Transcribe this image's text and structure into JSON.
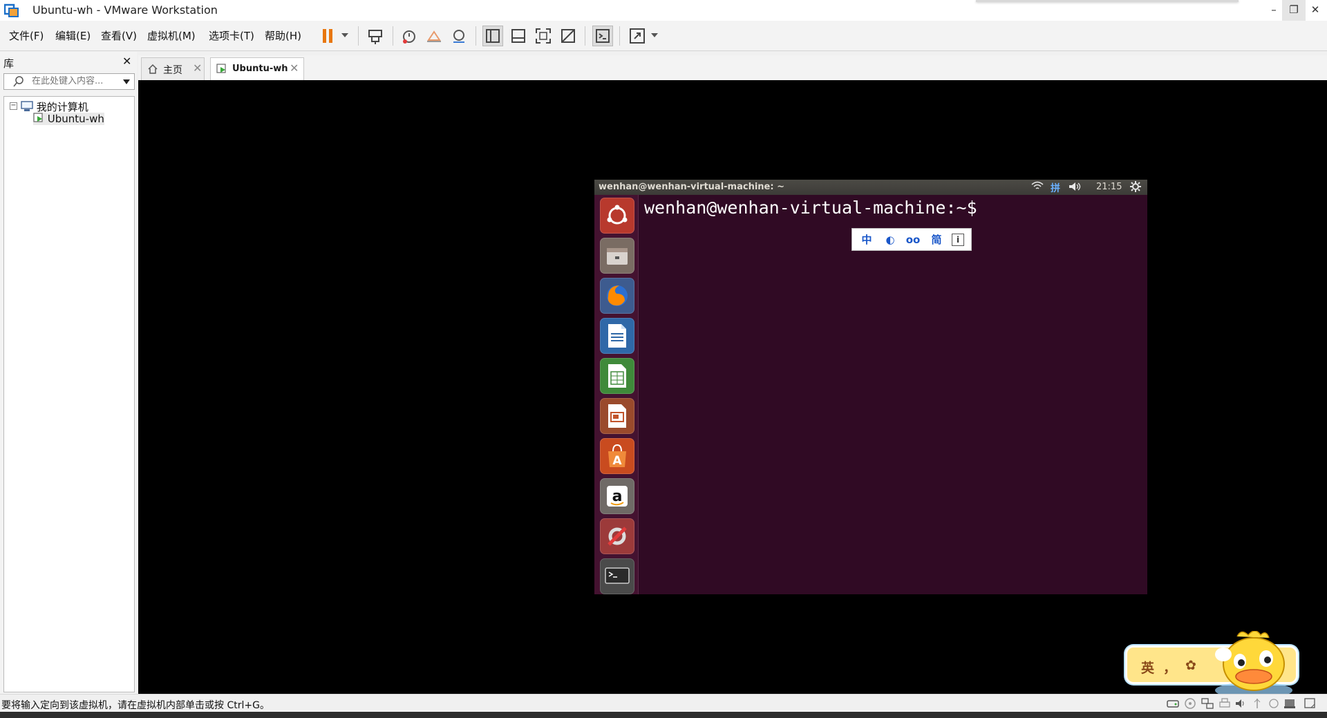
{
  "window": {
    "title": "Ubuntu-wh - VMware Workstation",
    "minimize": "–",
    "restore": "❐",
    "close": "✕"
  },
  "menu": {
    "file": "文件(F)",
    "edit": "编辑(E)",
    "view": "查看(V)",
    "vm": "虚拟机(M)",
    "tabs": "选项卡(T)",
    "help": "帮助(H)"
  },
  "toolbar": {
    "icons": [
      "pause-icon",
      "send-ctrl-alt-del-icon",
      "snapshot-icon",
      "revert-snapshot-icon",
      "snapshot-manager-icon",
      "show-library-icon",
      "show-thumbnail-icon",
      "full-screen-icon",
      "unity-icon",
      "console-view-icon",
      "stretch-guest-icon"
    ],
    "pause_color": "#e8770f"
  },
  "library": {
    "title": "库",
    "close": "✕",
    "search_placeholder": "在此处键入内容...",
    "tree_root": "我的计算机",
    "tree_root_toggle": "−",
    "tree_child": "Ubuntu-wh"
  },
  "tabs": [
    {
      "label": "主页",
      "close": "✕",
      "icon": "home-icon"
    },
    {
      "label": "Ubuntu-wh",
      "close": "✕",
      "icon": "vm-icon",
      "active": true
    }
  ],
  "guest": {
    "window_title": "wenhan@wenhan-virtual-machine: ~",
    "clock": "21:15",
    "ime_indicator": "拼",
    "prompt": "wenhan@wenhan-virtual-machine:~$",
    "ime_toolbar": [
      "中",
      "◐",
      "oo",
      "简",
      "i"
    ],
    "launcher": [
      "ubuntu-dash-icon",
      "files-icon",
      "firefox-icon",
      "writer-icon",
      "calc-icon",
      "impress-icon",
      "software-center-icon",
      "amazon-icon",
      "system-settings-icon",
      "terminal-icon"
    ],
    "colors": {
      "terminal_bg": "#300a24",
      "topbar_bg": "#3c3b37"
    }
  },
  "ime_float": {
    "mode": "英",
    "punct": "，",
    "settings": "✿"
  },
  "status": {
    "message": "要将输入定向到该虚拟机，请在虚拟机内部单击或按 Ctrl+G。",
    "icons": [
      "hdd-icon",
      "cd-icon",
      "network-icon",
      "printer-icon",
      "sound-icon",
      "usb-icon",
      "display-icon",
      "message-icon"
    ]
  }
}
